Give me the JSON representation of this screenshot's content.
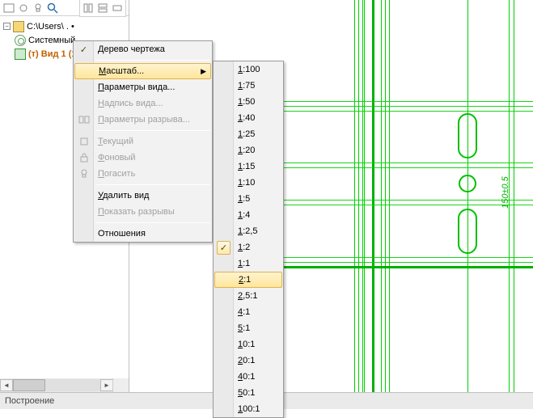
{
  "tree": {
    "root_label": "C:\\Users\\",
    "root_ellipsis": ". •",
    "system_label": "Системный",
    "view_label": "(т) Вид 1 (1:"
  },
  "statusbar": {
    "mode": "Построение"
  },
  "ctx": {
    "drawing_tree": "Дерево чертежа",
    "scale": "Масштаб...",
    "view_params": "Параметры вида...",
    "view_caption": "Надпись вида...",
    "break_params": "Параметры разрыва...",
    "current": "Текущий",
    "background": "Фоновый",
    "hide": "Погасить",
    "delete_view": "Удалить вид",
    "show_breaks": "Показать разрывы",
    "relations": "Отношения"
  },
  "scales": {
    "items": [
      "1:100",
      "1:75",
      "1:50",
      "1:40",
      "1:25",
      "1:20",
      "1:15",
      "1:10",
      "1:5",
      "1:4",
      "1:2,5",
      "1:2",
      "1:1",
      "2:1",
      "2,5:1",
      "4:1",
      "5:1",
      "10:1",
      "20:1",
      "40:1",
      "50:1",
      "100:1"
    ],
    "checked": "1:2",
    "highlighted": "2:1"
  },
  "drawing": {
    "dimension_label": "150±0.5"
  }
}
